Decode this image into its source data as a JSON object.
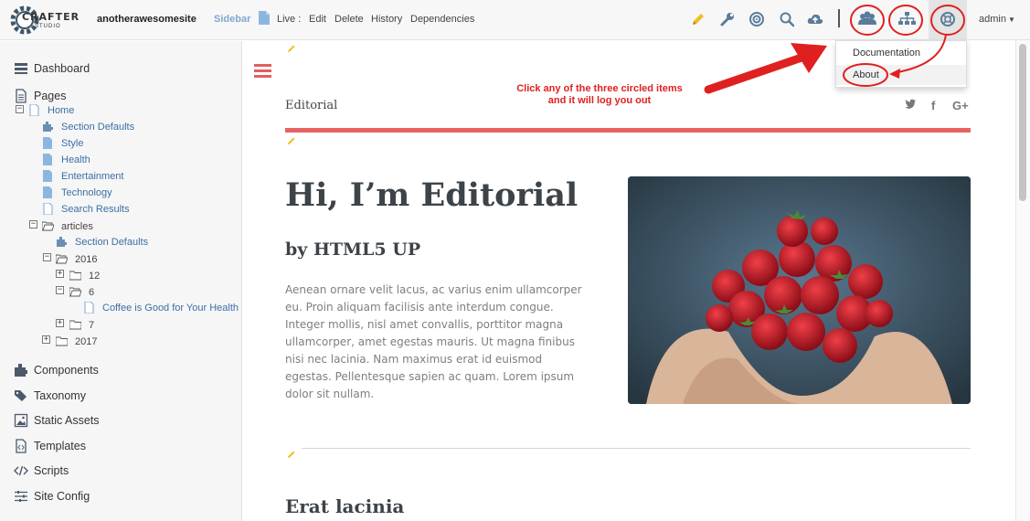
{
  "topbar": {
    "logo_text": "CRAFTER",
    "logo_subtext": "STUDIO",
    "site_name": "anotherawesomesite",
    "sidebar_label": "Sidebar",
    "page_icon": "file-icon",
    "live_label": "Live :",
    "edit_label": "Edit",
    "delete_label": "Delete",
    "history_label": "History",
    "dependencies_label": "Dependencies",
    "icons": [
      "pencil-icon",
      "wrench-icon",
      "target-icon",
      "search-icon",
      "cloud-upload-icon",
      "users-icon",
      "sitemap-icon",
      "help-icon"
    ],
    "user_label": "admin",
    "accent_color": "#f0c020"
  },
  "help_menu": {
    "documentation_label": "Documentation",
    "about_label": "About"
  },
  "annotation": {
    "line1": "Click any of the three circled items",
    "line2": "and it will log you out",
    "color": "#e02020"
  },
  "sidebar": {
    "dashboard_label": "Dashboard",
    "pages_label": "Pages",
    "tree": {
      "home": "Home",
      "section_defaults": "Section Defaults",
      "style": "Style",
      "health": "Health",
      "entertainment": "Entertainment",
      "technology": "Technology",
      "search_results": "Search Results",
      "articles": "articles",
      "articles_section_defaults": "Section Defaults",
      "y2016": "2016",
      "m12": "12",
      "m6": "6",
      "coffee": "Coffee is Good for Your Health",
      "m7": "7",
      "y2017": "2017"
    },
    "components_label": "Components",
    "taxonomy_label": "Taxonomy",
    "static_assets_label": "Static Assets",
    "templates_label": "Templates",
    "scripts_label": "Scripts",
    "site_config_label": "Site Config"
  },
  "content": {
    "section_label": "Editorial",
    "social": {
      "twitter": "🐦",
      "facebook": "f",
      "gplus": "G+"
    },
    "hero_title": "Hi, I’m Editorial",
    "hero_subtitle": "by HTML5 UP",
    "hero_body": "Aenean ornare velit lacus, ac varius enim ullamcorper eu. Proin aliquam facilisis ante interdum congue. Integer mollis, nisl amet convallis, porttitor magna ullamcorper, amet egestas mauris. Ut magna finibus nisi nec lacinia. Nam maximus erat id euismod egestas. Pellentesque sapien ac quam. Lorem ipsum dolor sit nullam.",
    "section_title": "Erat lacinia",
    "accent_color": "#e86464"
  }
}
